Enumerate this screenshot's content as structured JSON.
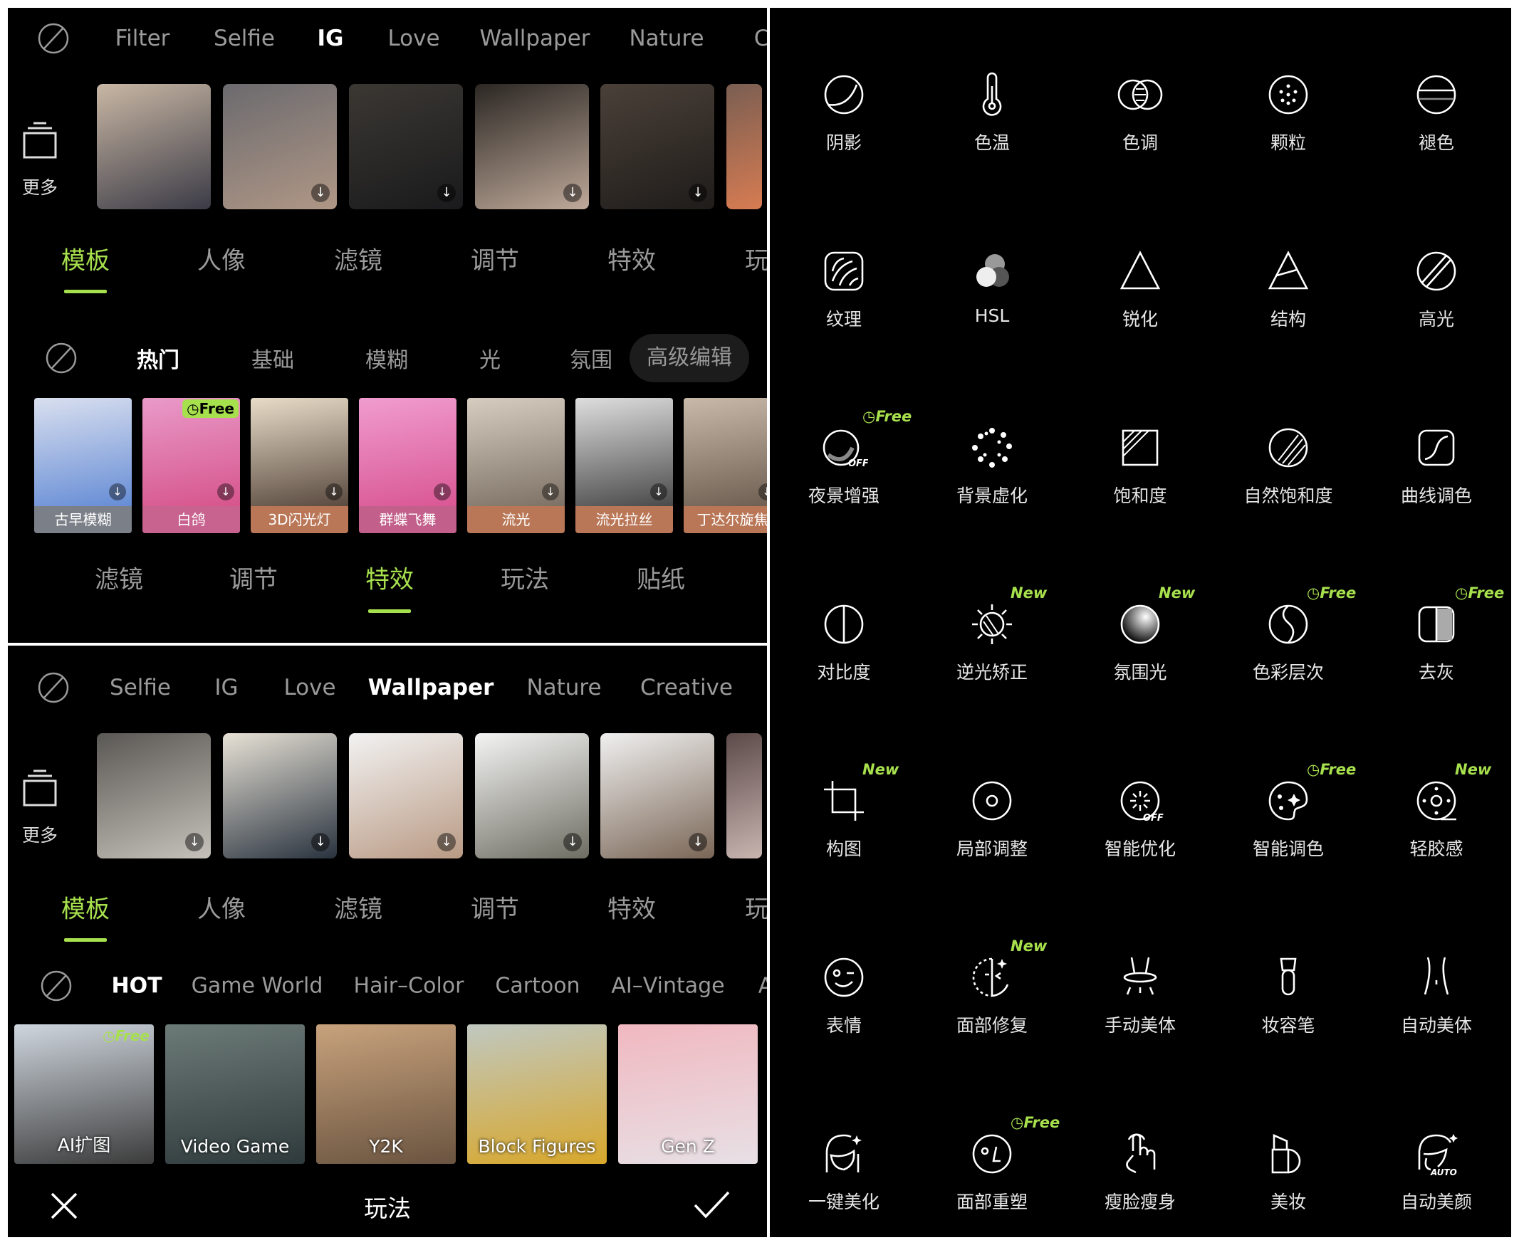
{
  "panel_top": {
    "categories": [
      "Filter",
      "Selfie",
      "IG",
      "Love",
      "Wallpaper",
      "Nature",
      "Cr"
    ],
    "active_category": "IG",
    "more_label": "更多",
    "main_tabs": [
      "模板",
      "人像",
      "滤镜",
      "调节",
      "特效",
      "玩"
    ],
    "active_main_tab": "模板",
    "sub_tabs": [
      "热门",
      "基础",
      "模糊",
      "光",
      "氛围"
    ],
    "active_sub_tab": "热门",
    "advanced_edit_label": "高级编辑",
    "effects": [
      {
        "label": "古早模糊",
        "color": "#7b8088"
      },
      {
        "label": "白鸽",
        "color": "#c8638f",
        "badge": "Free"
      },
      {
        "label": "3D闪光灯",
        "color": "#b97757"
      },
      {
        "label": "群蝶飞舞",
        "color": "#c25f8a"
      },
      {
        "label": "流光",
        "color": "#b97757"
      },
      {
        "label": "流光拉丝",
        "color": "#b97757"
      },
      {
        "label": "丁达尔旋焦",
        "color": "#b97757"
      }
    ],
    "bottom_tabs": [
      "滤镜",
      "调节",
      "特效",
      "玩法",
      "贴纸"
    ],
    "active_bottom_tab": "特效"
  },
  "panel_bottom": {
    "categories": [
      "Selfie",
      "IG",
      "Love",
      "Wallpaper",
      "Nature",
      "Creative"
    ],
    "active_category": "Wallpaper",
    "more_label": "更多",
    "main_tabs": [
      "模板",
      "人像",
      "滤镜",
      "调节",
      "特效",
      "玩"
    ],
    "active_main_tab": "模板",
    "sub_tabs": [
      "HOT",
      "Game World",
      "Hair–Color",
      "Cartoon",
      "AI–Vintage",
      "A"
    ],
    "active_sub_tab": "HOT",
    "play_items": [
      {
        "label": "AI扩图",
        "badge": "Free"
      },
      {
        "label": "Video Game"
      },
      {
        "label": "Y2K"
      },
      {
        "label": "Block Figures"
      },
      {
        "label": "Gen Z"
      }
    ],
    "title": "玩法",
    "close_icon": "close-icon",
    "confirm_icon": "check-icon"
  },
  "tools_panel": {
    "accent_color": "#a7e04d",
    "items": [
      {
        "label": "阴影",
        "icon": "shadow"
      },
      {
        "label": "色温",
        "icon": "thermometer"
      },
      {
        "label": "色调",
        "icon": "tone"
      },
      {
        "label": "颗粒",
        "icon": "grain"
      },
      {
        "label": "褪色",
        "icon": "fade"
      },
      {
        "label": "纹理",
        "icon": "texture"
      },
      {
        "label": "HSL",
        "icon": "hsl"
      },
      {
        "label": "锐化",
        "icon": "sharpen"
      },
      {
        "label": "结构",
        "icon": "structure"
      },
      {
        "label": "高光",
        "icon": "highlight"
      },
      {
        "label": "夜景增强",
        "icon": "night",
        "badge": "Free"
      },
      {
        "label": "背景虚化",
        "icon": "bokeh"
      },
      {
        "label": "饱和度",
        "icon": "saturation"
      },
      {
        "label": "自然饱和度",
        "icon": "vibrance"
      },
      {
        "label": "曲线调色",
        "icon": "curve"
      },
      {
        "label": "对比度",
        "icon": "contrast"
      },
      {
        "label": "逆光矫正",
        "icon": "backlight",
        "badge": "New"
      },
      {
        "label": "氛围光",
        "icon": "ambient",
        "badge": "New"
      },
      {
        "label": "色彩层次",
        "icon": "color-layer",
        "badge": "Free"
      },
      {
        "label": "去灰",
        "icon": "dehaze",
        "badge": "Free"
      },
      {
        "label": "构图",
        "icon": "crop",
        "badge": "New"
      },
      {
        "label": "局部调整",
        "icon": "local",
        "badge": ""
      },
      {
        "label": "智能优化",
        "icon": "smart",
        "badge": ""
      },
      {
        "label": "智能调色",
        "icon": "palette",
        "badge": "Free"
      },
      {
        "label": "轻胶感",
        "icon": "film",
        "badge": "New"
      },
      {
        "label": "表情",
        "icon": "expression"
      },
      {
        "label": "面部修复",
        "icon": "face-repair",
        "badge": "New"
      },
      {
        "label": "手动美体",
        "icon": "body"
      },
      {
        "label": "妆容笔",
        "icon": "brush"
      },
      {
        "label": "自动美体",
        "icon": "auto-body"
      },
      {
        "label": "一键美化",
        "icon": "beautify"
      },
      {
        "label": "面部重塑",
        "icon": "reshape",
        "badge": "Free"
      },
      {
        "label": "瘦脸瘦身",
        "icon": "slim"
      },
      {
        "label": "美妆",
        "icon": "makeup"
      },
      {
        "label": "自动美颜",
        "icon": "auto-beauty"
      }
    ]
  }
}
